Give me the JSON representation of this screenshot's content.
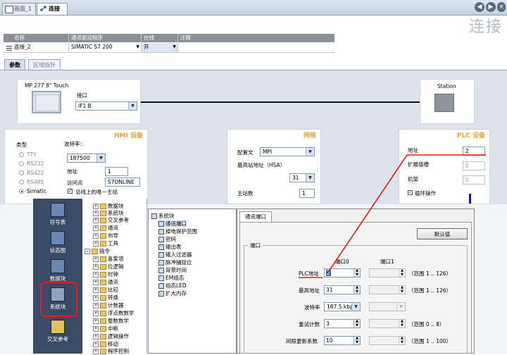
{
  "tabs": [
    {
      "label": "画面_1"
    },
    {
      "label": "连接"
    }
  ],
  "page_title": "连接",
  "connection_table": {
    "headers": [
      "名称",
      "通讯驱动程序",
      "在线",
      "注释"
    ],
    "row": {
      "name": "连接_2",
      "driver": "SIMATIC S7 200",
      "online": "开",
      "comment": ""
    }
  },
  "param_tabs": [
    "参数",
    "区域指针"
  ],
  "device": {
    "hmi_name": "MP 277 8\" Touch",
    "interface_label": "接口",
    "interface_value": "IF1 B",
    "station_label": "Station"
  },
  "hmi": {
    "title": "HMI 设备",
    "type_label": "类型",
    "types": [
      "TTY",
      "RS232",
      "RS422",
      "RS485",
      "Simatic"
    ],
    "selected_type": "Simatic",
    "baud_label": "波特率：",
    "baud_value": "187500",
    "address_label": "地址",
    "address_value": "1",
    "access_label": "访问点",
    "access_value": "S7ONLINE",
    "only_master_label": "总线上的唯一主站"
  },
  "network": {
    "title": "网络",
    "profile_label": "配置文",
    "profile_value": "MPI",
    "hsa_label": "最高站地址（HSA）",
    "hsa_value": "31",
    "master_label": "主站数",
    "master_value": "1"
  },
  "plc": {
    "title": "PLC 设备",
    "address_label": "地址",
    "address_value": "2",
    "ext_label": "扩展插槽",
    "ext_value": "0",
    "rack_label": "机架",
    "rack_value": "0",
    "cyclic_label": "循环操作"
  },
  "sidebar": [
    {
      "label": "符号表"
    },
    {
      "label": "状态图"
    },
    {
      "label": "数据块"
    },
    {
      "label": "系统块"
    },
    {
      "label": "交叉参考"
    }
  ],
  "tree": [
    {
      "label": "数据块"
    },
    {
      "label": "系统块"
    },
    {
      "label": "交叉参考"
    },
    {
      "label": "通讯"
    },
    {
      "label": "向导"
    },
    {
      "label": "工具"
    },
    {
      "label": "指令"
    },
    {
      "label": "喜爱项"
    },
    {
      "label": "位逻辑"
    },
    {
      "label": "时钟"
    },
    {
      "label": "通讯"
    },
    {
      "label": "比较"
    },
    {
      "label": "转换"
    },
    {
      "label": "计数器"
    },
    {
      "label": "浮点数数学"
    },
    {
      "label": "整数数学"
    },
    {
      "label": "中断"
    },
    {
      "label": "逻辑操作"
    },
    {
      "label": "移动"
    },
    {
      "label": "程序控制"
    }
  ],
  "system_block": {
    "root": "系统块",
    "items": [
      "通讯端口",
      "掉电保护范围",
      "密码",
      "输出表",
      "输入过滤器",
      "脉冲捕捉位",
      "背景时间",
      "EM组态",
      "组态LED",
      "扩大内存"
    ]
  },
  "comm_port": {
    "tab": "通讯端口",
    "default_btn": "默认值",
    "group": "端口",
    "col0": "端口0",
    "col1": "端口1",
    "rows": [
      {
        "label": "PLC地址",
        "p0": "2",
        "p1": "",
        "range": "（范围 1 .. 126）"
      },
      {
        "label": "最高地址",
        "p0": "31",
        "p1": "",
        "range": "（范围 1 .. 126）"
      },
      {
        "label": "波特率",
        "p0": "187.5 kbps",
        "p1": "",
        "range": ""
      },
      {
        "label": "重试计数",
        "p0": "3",
        "p1": "",
        "range": "（范围 0 .. 8）"
      },
      {
        "label": "间隙更新系数",
        "p0": "10",
        "p1": "",
        "range": "（范围 1 .. 100）"
      }
    ]
  },
  "colors": {
    "accent": "#e8a33c",
    "sidebar": "#3b4a63",
    "annotation": "#e01c1c"
  }
}
